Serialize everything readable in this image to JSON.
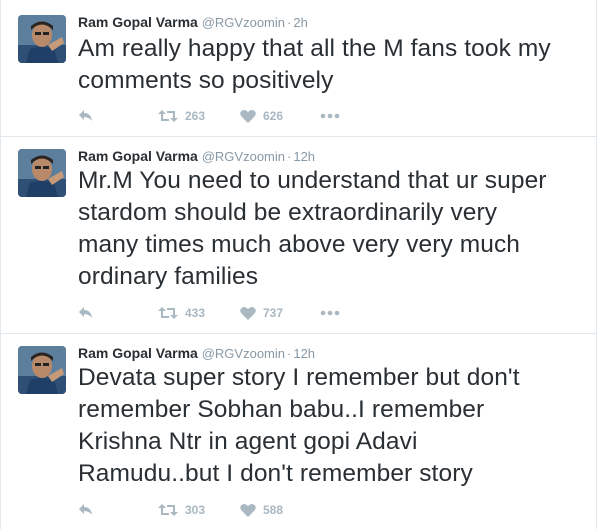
{
  "tweets": [
    {
      "name": "Ram Gopal Varma",
      "handle": "@RGVzoomin",
      "separator": "·",
      "time": "2h",
      "text_lines": [
        "Am really happy that all the M fans took my",
        "comments so positively"
      ],
      "retweets": "263",
      "likes": "626"
    },
    {
      "name": "Ram Gopal Varma",
      "handle": "@RGVzoomin",
      "separator": "·",
      "time": "12h",
      "text_lines": [
        "Mr.M You need to understand that ur super",
        "stardom should be extraordinarily very",
        "many times much above very very much",
        "ordinary families"
      ],
      "retweets": "433",
      "likes": "737"
    },
    {
      "name": "Ram Gopal Varma",
      "handle": "@RGVzoomin",
      "separator": "·",
      "time": "12h",
      "text_lines": [
        "Devata super story I remember but don't",
        "remember Sobhan babu..I remember",
        "Krishna Ntr in agent gopi Adavi",
        "Ramudu..but I don't remember story"
      ],
      "retweets": "303",
      "likes": "588"
    }
  ],
  "icons": {
    "reply": "reply-icon",
    "retweet": "retweet-icon",
    "like": "heart-icon",
    "more": "more-icon"
  },
  "colors": {
    "name": "#292f33",
    "meta": "#8899a6",
    "action": "#aab8c2",
    "divider": "#e1e8ed"
  }
}
